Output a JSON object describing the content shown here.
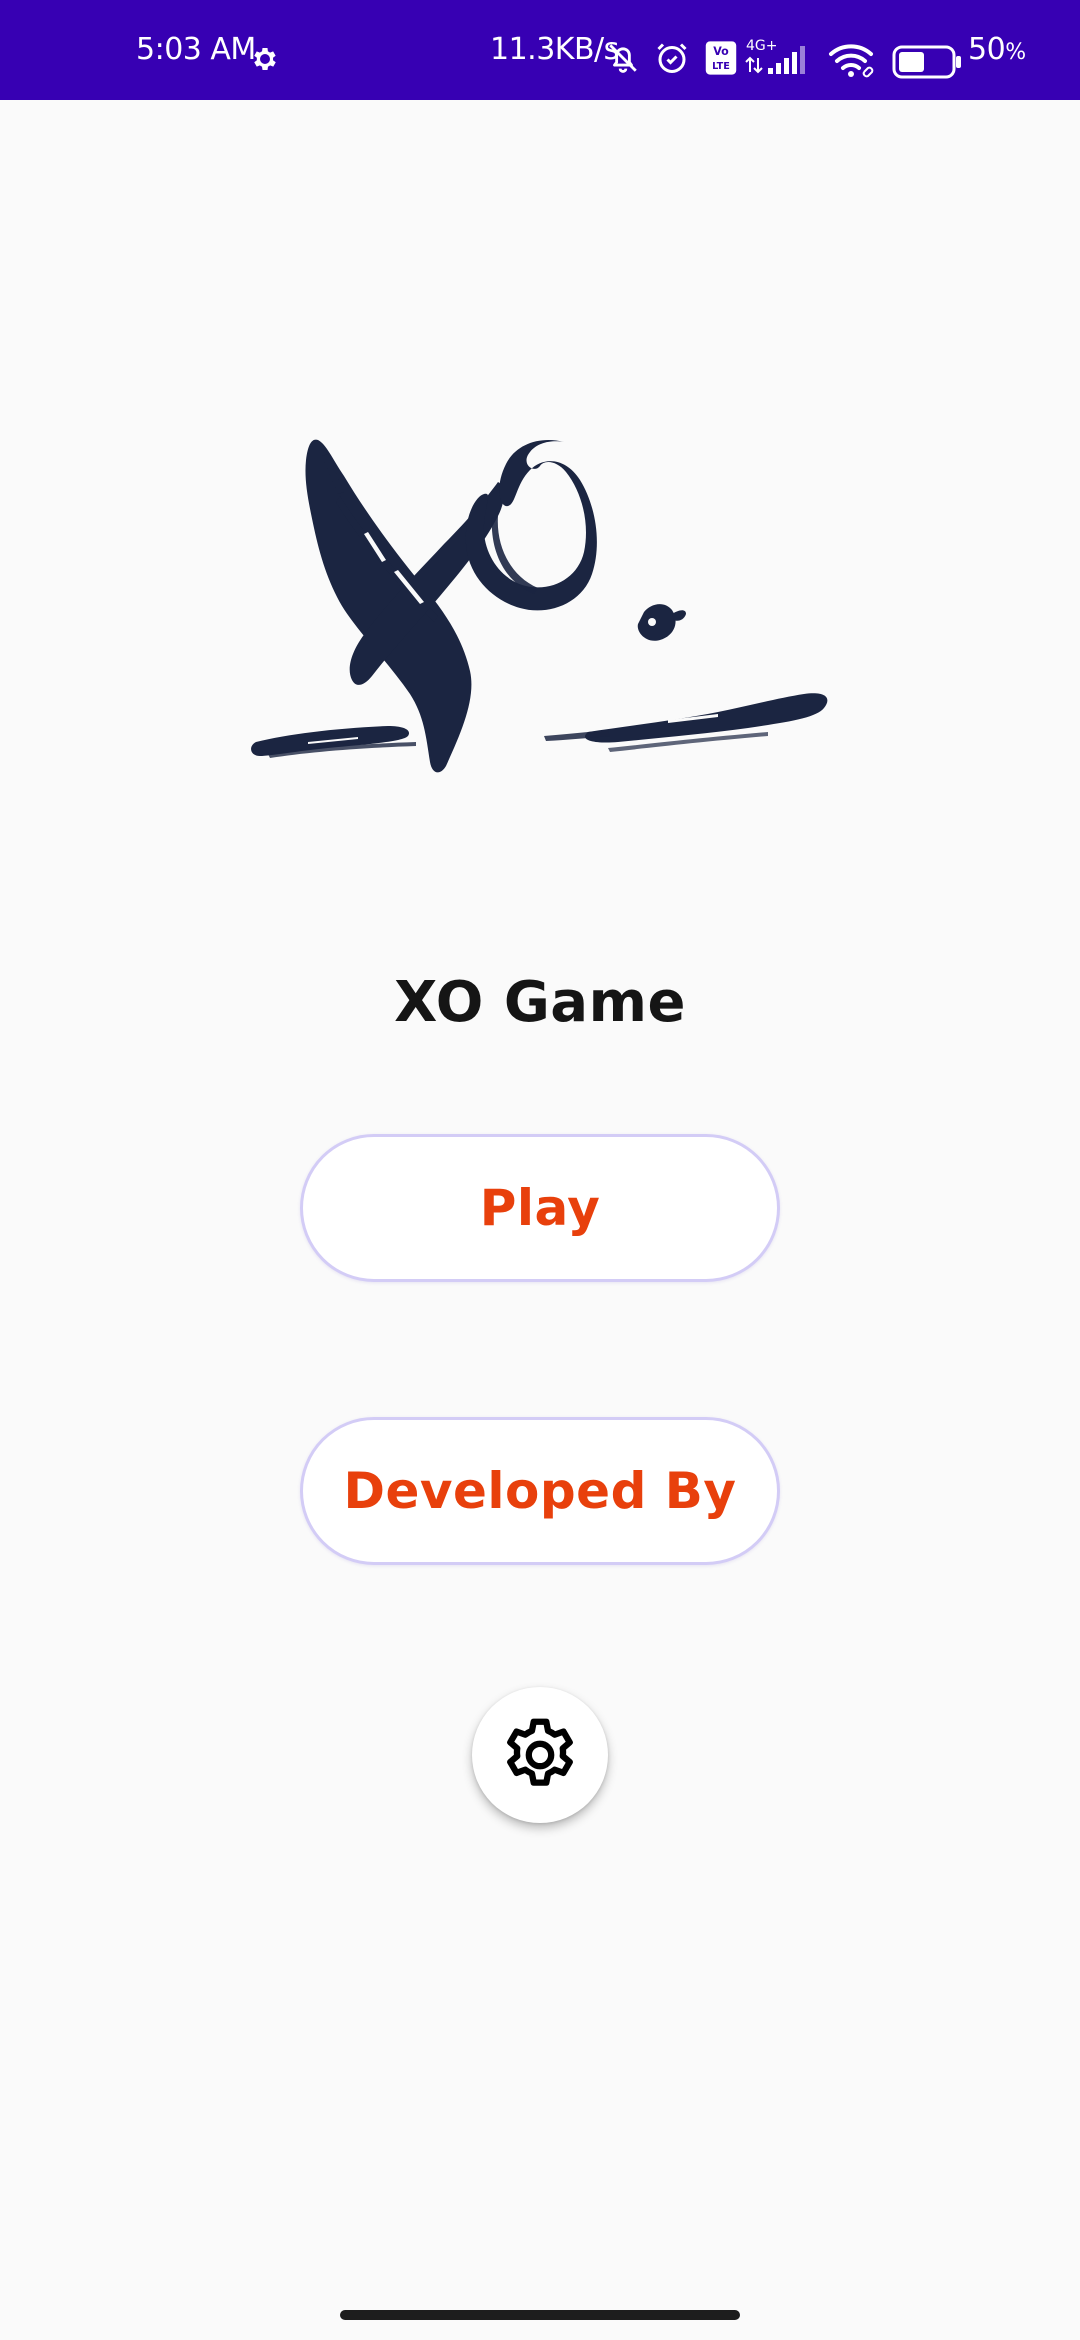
{
  "status_bar": {
    "time": "5:03 AM",
    "network_speed": "11.3KB/s",
    "network_type": "4G+",
    "volte_label": "Vo LTE",
    "battery_percent": "50",
    "battery_unit": "%",
    "battery_level": 0.5,
    "icons": [
      "gear-icon",
      "mute-icon",
      "alarm-icon",
      "volte-icon",
      "signal-icon",
      "wifi-icon",
      "battery-icon"
    ]
  },
  "app": {
    "logo_icon": "xo-brush-logo",
    "title": "XO Game",
    "play_label": "Play",
    "developed_by_label": "Developed By",
    "settings_icon": "gear-icon"
  },
  "colors": {
    "status_bar": "#3700b3",
    "background": "#fafafa",
    "button_text": "#e8400c",
    "button_border": "#d3ccf6",
    "logo": "#1b2541"
  }
}
